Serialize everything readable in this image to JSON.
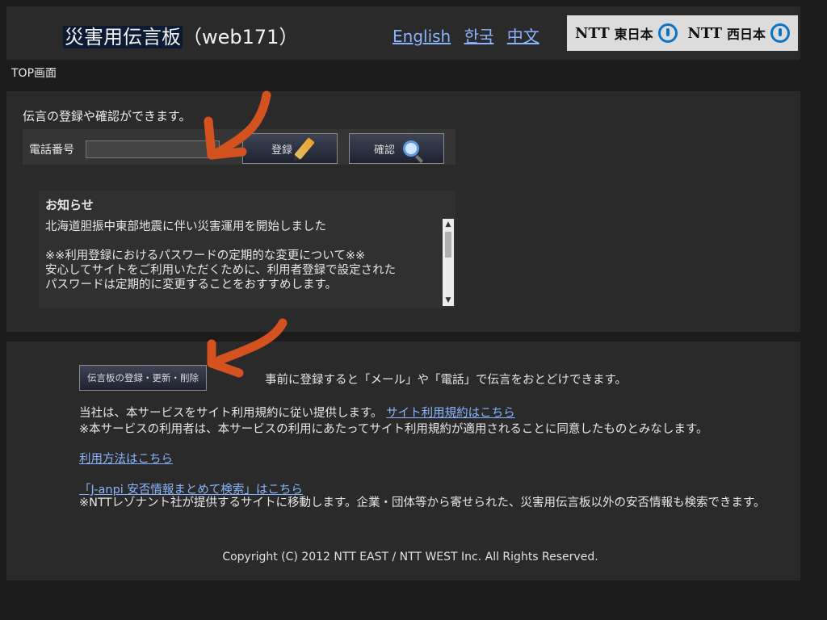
{
  "header": {
    "title_main": "災害用伝言板",
    "title_suffix": "（web171）",
    "languages": [
      "English",
      "한국",
      "中文"
    ],
    "ntt_east": "東日本",
    "ntt_west": "西日本",
    "ntt_brand": "NTT"
  },
  "breadcrumb": "TOP画面",
  "message_section": {
    "intro": "伝言の登録や確認ができます。",
    "phone_label": "電話番号",
    "phone_value": "",
    "register_label": "登録",
    "confirm_label": "確認"
  },
  "notice": {
    "title": "お知らせ",
    "lines": [
      "北海道胆振中東部地震に伴い災害運用を開始しました",
      "",
      "※※利用登録におけるパスワードの定期的な変更について※※",
      "安心してサイトをご利用いただくために、利用者登録で設定された",
      "パスワードは定期的に変更することをおすすめします。"
    ]
  },
  "lower_section": {
    "manage_button": "伝言板の登録・更新・削除",
    "manage_desc": "事前に登録すると「メール」や「電話」で伝言をおとどけできます。",
    "terms_text": "当社は、本サービスをサイト利用規約に従い提供します。",
    "terms_link": "サイト利用規約はこちら",
    "terms_note": "※本サービスの利用者は、本サービスの利用にあたってサイト利用規約が適用されることに同意したものとみなします。",
    "howto_link": "利用方法はこちら",
    "janpi_link": "「J-anpi 安否情報まとめて検索」はこちら",
    "janpi_note": "※NTTレゾナント社が提供するサイトに移動します。企業・団体等から寄せられた、災害用伝言板以外の安否情報も検索できます。",
    "copyright": "Copyright (C) 2012 NTT EAST / NTT WEST Inc. All Rights Reserved."
  },
  "colors": {
    "background": "#1c1c1c",
    "panel": "#2a2a2a",
    "link": "#8ab4ff",
    "annotation_arrow": "#d4521f"
  }
}
